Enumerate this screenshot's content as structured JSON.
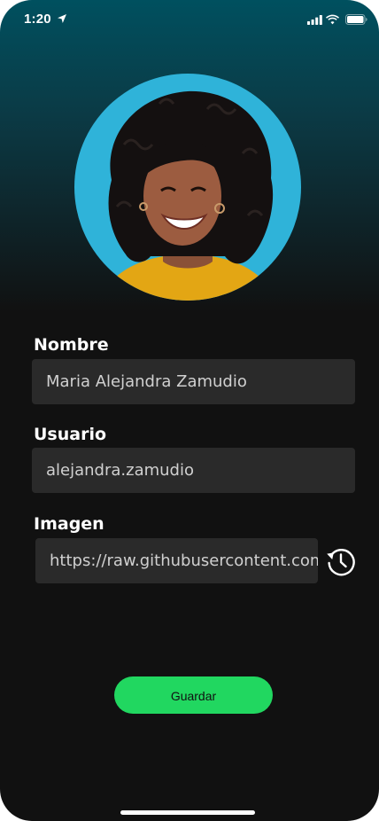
{
  "status_bar": {
    "time": "1:20",
    "icons": [
      "location-arrow-icon",
      "cellular-signal-icon",
      "wifi-icon",
      "battery-icon"
    ]
  },
  "profile": {
    "avatar": "profile-photo",
    "fields": {
      "name": {
        "label": "Nombre",
        "value": "Maria Alejandra Zamudio"
      },
      "username": {
        "label": "Usuario",
        "value": "alejandra.zamudio"
      },
      "image": {
        "label": "Imagen",
        "value": "https://raw.githubusercontent.com"
      }
    },
    "history_icon": "history-icon"
  },
  "actions": {
    "save_label": "Guardar"
  },
  "colors": {
    "background": "#111111",
    "gradient_top": "#00505f",
    "field_bg": "#2a2a2a",
    "accent": "#21d760",
    "avatar_bg": "#2fb3d9"
  }
}
